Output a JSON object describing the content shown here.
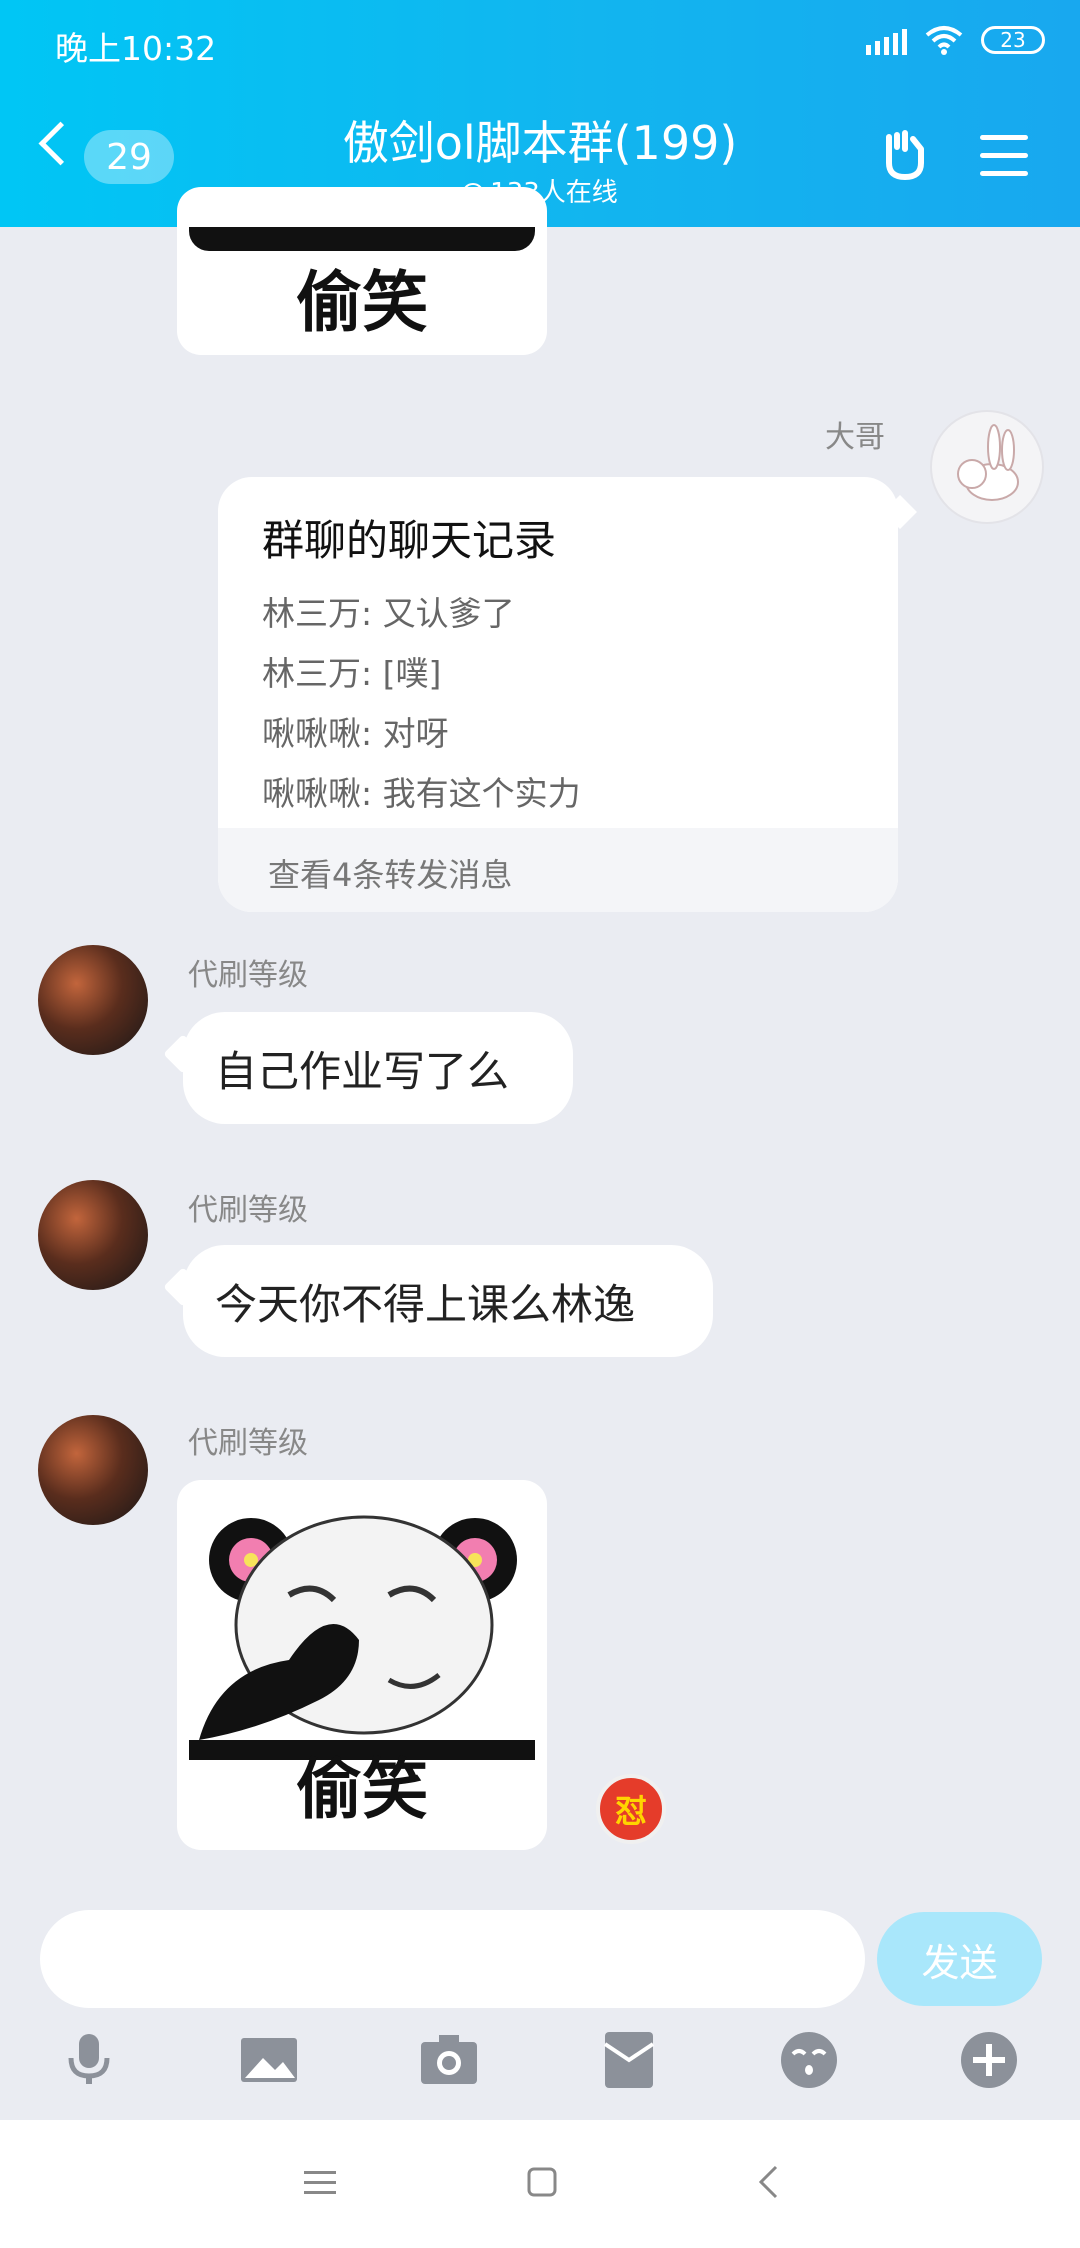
{
  "status_bar": {
    "time": "晚上10:32",
    "battery": "23"
  },
  "header": {
    "unread_count": "29",
    "title": "傲剑ol脚本群(199)",
    "online": "133人在线"
  },
  "messages": {
    "top_sticker_caption": "偷笑",
    "forward": {
      "sender": "大哥",
      "title": "群聊的聊天记录",
      "lines": [
        "林三万:  又认爹了",
        "林三万:  [噗]",
        "啾啾啾:  对呀",
        "啾啾啾:  我有这个实力"
      ],
      "footer": "查看4条转发消息"
    },
    "msg1": {
      "sender": "代刷等级",
      "text": "自己作业写了么"
    },
    "msg2": {
      "sender": "代刷等级",
      "text": "今天你不得上课么林逸"
    },
    "msg3": {
      "sender": "代刷等级",
      "sticker_caption": "偷笑"
    },
    "reaction_badge": "怼"
  },
  "input": {
    "placeholder": "",
    "send_label": "发送"
  },
  "toolbar_icons": [
    "microphone-icon",
    "image-icon",
    "camera-icon",
    "red-packet-icon",
    "emoji-icon",
    "plus-icon"
  ],
  "colors": {
    "header_start": "#00c6f5",
    "header_end": "#18a8ef",
    "background": "#eaecf2",
    "send_button": "#a9e7fb"
  }
}
